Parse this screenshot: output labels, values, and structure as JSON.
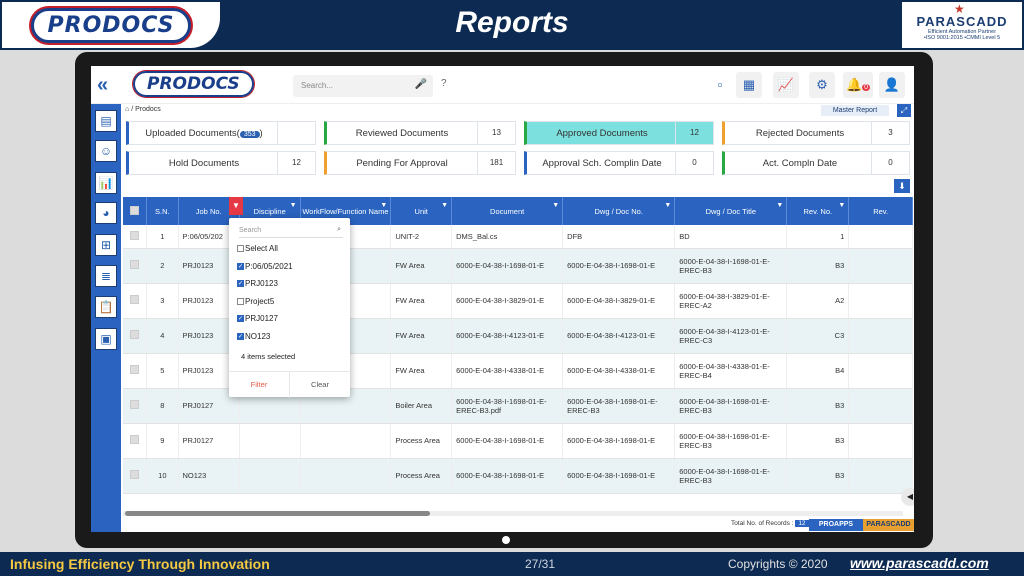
{
  "slide": {
    "title": "Reports",
    "logo_left": "PRODOCS",
    "logo_right_name": "PARASCADD",
    "logo_right_tag1": "Efficient Automation Partner",
    "logo_right_tag2": "•ISO 9001:2015 •CMMI Level 5",
    "tagline": "Infusing Efficiency Through Innovation",
    "page": "27/31",
    "copyright": "Copyrights © 2020",
    "url": "www.parascadd.com"
  },
  "app": {
    "logo": "PRODOCS",
    "search_placeholder": "Search...",
    "help": "?",
    "notif_count": "0",
    "breadcrumb": "/ Prodocs",
    "master_report": "Master Report",
    "total_label": "Total No. of Records :",
    "total_count": "12",
    "footer_tag1": "PROAPPS",
    "footer_tag2": "PARASCADD"
  },
  "cards": [
    {
      "label": "Uploaded Documents(",
      "badge": "353",
      "suffix": ")",
      "count": ""
    },
    {
      "label": "Reviewed Documents",
      "count": "13"
    },
    {
      "label": "Approved Documents",
      "count": "12"
    },
    {
      "label": "Rejected Documents",
      "count": "3"
    },
    {
      "label": "Hold Documents",
      "count": "12"
    },
    {
      "label": "Pending For Approval",
      "count": "181"
    },
    {
      "label": "Approval Sch. Complin Date",
      "count": "0"
    },
    {
      "label": "Act. Compln Date",
      "count": "0"
    }
  ],
  "table": {
    "headers": [
      "S.N.",
      "Job No.",
      "Discipline",
      "WorkFlow/Function Name",
      "Unit",
      "Document",
      "Dwg / Doc No.",
      "Dwg / Doc Title",
      "Rev. No.",
      "Rev."
    ],
    "rows": [
      {
        "sn": "1",
        "job": "P:06/05/202",
        "disc": "",
        "wf": "",
        "unit": "UNIT-2",
        "doc": "DMS_Bal.cs",
        "dwg": "DFB",
        "title": "BD",
        "rev": "1"
      },
      {
        "sn": "2",
        "job": "PRJ0123",
        "disc": "",
        "wf": "",
        "unit": "FW Area",
        "doc": "6000-E-04-38-I-1698-01-E",
        "dwg": "6000-E-04-38-I-1698-01-E",
        "title": "6000-E-04-38-I-1698-01-E-EREC-B3",
        "rev": "B3"
      },
      {
        "sn": "3",
        "job": "PRJ0123",
        "disc": "",
        "wf": "",
        "unit": "FW Area",
        "doc": "6000-E-04-38-I-3829-01-E",
        "dwg": "6000-E-04-38-I-3829-01-E",
        "title": "6000-E-04-38-I-3829-01-E-EREC-A2",
        "rev": "A2"
      },
      {
        "sn": "4",
        "job": "PRJ0123",
        "disc": "",
        "wf": "",
        "unit": "FW Area",
        "doc": "6000-E-04-38-I-4123-01-E",
        "dwg": "6000-E-04-38-I-4123-01-E",
        "title": "6000-E-04-38-I-4123-01-E-EREC-C3",
        "rev": "C3"
      },
      {
        "sn": "5",
        "job": "PRJ0123",
        "disc": "",
        "wf": "",
        "unit": "FW Area",
        "doc": "6000-E-04-38-I-4338-01-E",
        "dwg": "6000-E-04-38-I-4338-01-E",
        "title": "6000-E-04-38-I-4338-01-E-EREC-B4",
        "rev": "B4"
      },
      {
        "sn": "8",
        "job": "PRJ0127",
        "disc": "",
        "wf": "",
        "unit": "Boiler Area",
        "doc": "6000-E-04-38-I-1698-01-E-EREC-B3.pdf",
        "dwg": "6000-E-04-38-I-1698-01-E-EREC-B3",
        "title": "6000-E-04-38-I-1698-01-E-EREC-B3",
        "rev": "B3"
      },
      {
        "sn": "9",
        "job": "PRJ0127",
        "disc": "",
        "wf": "",
        "unit": "Process Area",
        "doc": "6000-E-04-38-I-1698-01-E",
        "dwg": "6000-E-04-38-I-1698-01-E",
        "title": "6000-E-04-38-I-1698-01-E-EREC-B3",
        "rev": "B3"
      },
      {
        "sn": "10",
        "job": "NO123",
        "disc": "",
        "wf": "",
        "unit": "Process Area",
        "doc": "6000-E-04-38-I-1698-01-E",
        "dwg": "6000-E-04-38-I-1698-01-E",
        "title": "6000-E-04-38-I-1698-01-E-EREC-B3",
        "rev": "B3"
      }
    ]
  },
  "filter_dropdown": {
    "search_placeholder": "Search",
    "items": [
      {
        "label": "Select All",
        "checked": false
      },
      {
        "label": "P:06/05/2021",
        "checked": true
      },
      {
        "label": "PRJ0123",
        "checked": true
      },
      {
        "label": "Project5",
        "checked": false
      },
      {
        "label": "PRJ0127",
        "checked": true
      },
      {
        "label": "NO123",
        "checked": true
      }
    ],
    "selected_text": "4 items selected",
    "filter_btn": "Filter",
    "clear_btn": "Clear"
  },
  "colors": {
    "primary": "#2a64c0",
    "navy": "#0d2b52",
    "active_card": "#7ce0de",
    "accent_gold": "#f5c842"
  }
}
